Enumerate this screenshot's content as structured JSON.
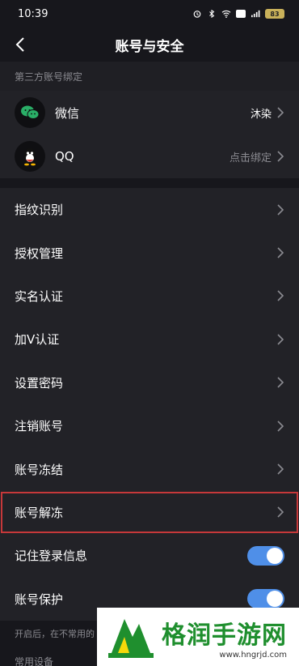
{
  "status_bar": {
    "time": "10:39",
    "battery": "83"
  },
  "nav": {
    "title": "账号与安全"
  },
  "third_party": {
    "header": "第三方账号绑定",
    "items": [
      {
        "label": "微信",
        "value": "沐染",
        "icon": "wechat-icon"
      },
      {
        "label": "QQ",
        "value": "点击绑定",
        "icon": "qq-icon"
      }
    ]
  },
  "settings": {
    "items": [
      {
        "label": "指纹识别"
      },
      {
        "label": "授权管理"
      },
      {
        "label": "实名认证"
      },
      {
        "label": "加V认证"
      },
      {
        "label": "设置密码"
      },
      {
        "label": "注销账号"
      },
      {
        "label": "账号冻结"
      },
      {
        "label": "账号解冻"
      }
    ]
  },
  "toggles": [
    {
      "label": "记住登录信息",
      "on": true
    },
    {
      "label": "账号保护",
      "on": true
    }
  ],
  "hint": "开启后，在不常用的",
  "bottom_cut": "常用设备",
  "watermark": {
    "title": "格润手游网",
    "url": "www.hngrjd.com"
  },
  "colors": {
    "background": "#17171c",
    "card": "#222227",
    "toggle_on": "#4f8fe8",
    "highlight": "#c6383a",
    "brand_green": "#1f8f2e"
  }
}
